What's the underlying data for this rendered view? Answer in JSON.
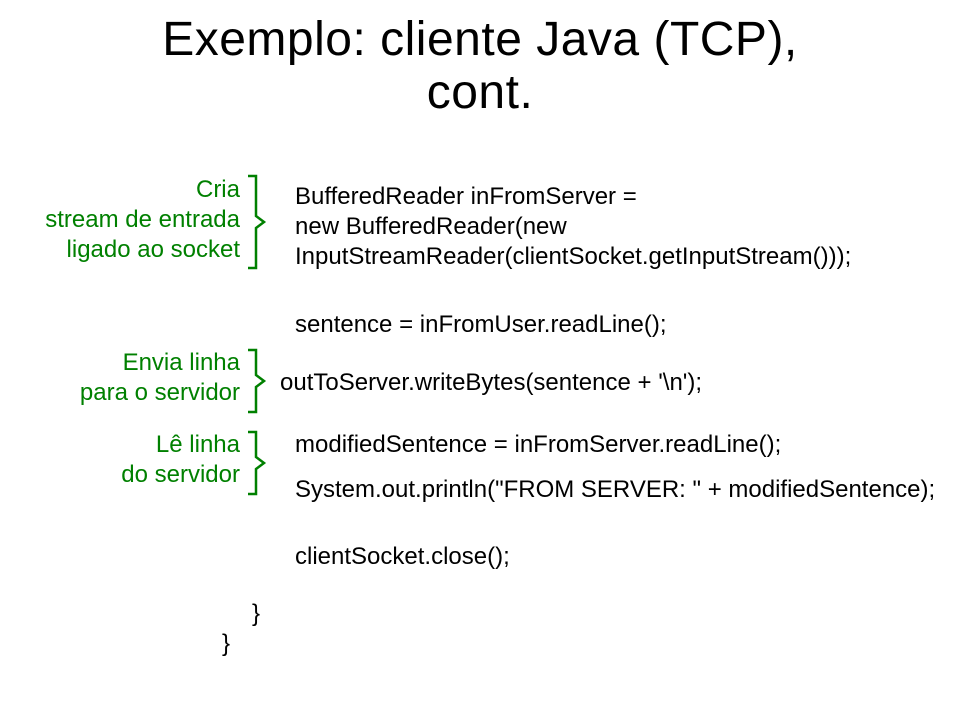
{
  "title_line1": "Exemplo: cliente Java (TCP),",
  "title_line2": "cont.",
  "annotations": {
    "a1_line1": "Cria",
    "a1_line2": "stream de entrada",
    "a1_line3": "ligado ao socket",
    "a2_line1": "Envia linha",
    "a2_line2": "para o servidor",
    "a3_line1": "Lê linha",
    "a3_line2": "do servidor"
  },
  "code": {
    "c1": "BufferedReader inFromServer =",
    "c2": " new BufferedReader(new",
    "c3": "InputStreamReader(clientSocket.getInputStream()));",
    "c4": "sentence = inFromUser.readLine();",
    "c5": "outToServer.writeBytes(sentence + '\\n');",
    "c6": "modifiedSentence = inFromServer.readLine();",
    "c7": "System.out.println(\"FROM SERVER: \" + modifiedSentence);",
    "c8": "clientSocket.close();",
    "b1": "}",
    "b2": "}"
  }
}
